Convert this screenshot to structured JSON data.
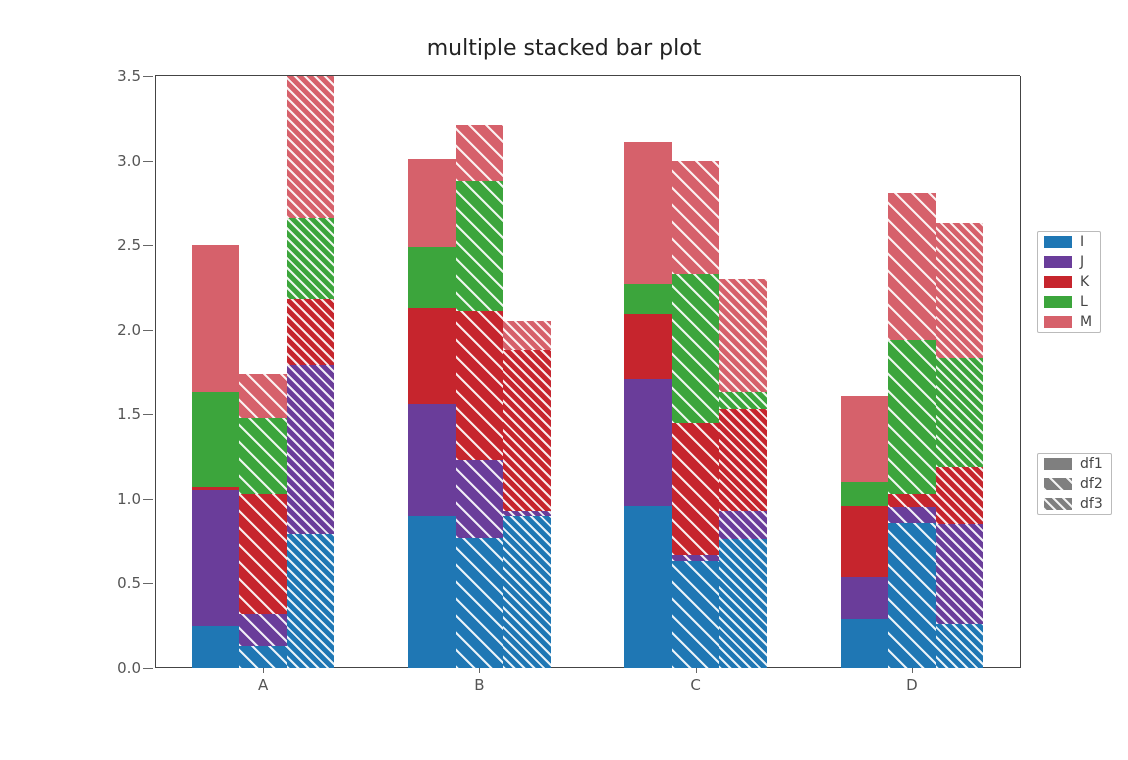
{
  "chart_data": {
    "type": "bar",
    "title": "multiple stacked bar plot",
    "xlabel": "",
    "ylabel": "",
    "ylim": [
      0,
      3.5
    ],
    "categories": [
      "A",
      "B",
      "C",
      "D"
    ],
    "stack_order": [
      "I",
      "J",
      "K",
      "L",
      "M"
    ],
    "groups": [
      {
        "name": "df1",
        "hatch": "solid",
        "series": [
          {
            "name": "I",
            "values": [
              0.25,
              0.9,
              0.96,
              0.29
            ]
          },
          {
            "name": "J",
            "values": [
              0.8,
              0.66,
              0.75,
              0.25
            ]
          },
          {
            "name": "K",
            "values": [
              0.02,
              0.57,
              0.38,
              0.42
            ]
          },
          {
            "name": "L",
            "values": [
              0.56,
              0.36,
              0.18,
              0.14
            ]
          },
          {
            "name": "M",
            "values": [
              0.87,
              0.52,
              0.84,
              0.51
            ]
          }
        ]
      },
      {
        "name": "df2",
        "hatch": "sparse",
        "series": [
          {
            "name": "I",
            "values": [
              0.13,
              0.77,
              0.63,
              0.86
            ]
          },
          {
            "name": "J",
            "values": [
              0.19,
              0.46,
              0.04,
              0.09
            ]
          },
          {
            "name": "K",
            "values": [
              0.71,
              0.88,
              0.78,
              0.08
            ]
          },
          {
            "name": "L",
            "values": [
              0.45,
              0.77,
              0.88,
              0.91
            ]
          },
          {
            "name": "M",
            "values": [
              0.26,
              0.33,
              0.67,
              0.87
            ]
          }
        ]
      },
      {
        "name": "df3",
        "hatch": "dense",
        "series": [
          {
            "name": "I",
            "values": [
              0.79,
              0.9,
              0.76,
              0.26
            ]
          },
          {
            "name": "J",
            "values": [
              1.0,
              0.03,
              0.17,
              0.59
            ]
          },
          {
            "name": "K",
            "values": [
              0.39,
              0.95,
              0.6,
              0.34
            ]
          },
          {
            "name": "L",
            "values": [
              0.48,
              0.0,
              0.1,
              0.64
            ]
          },
          {
            "name": "M",
            "values": [
              0.85,
              0.17,
              0.67,
              0.8
            ]
          }
        ]
      }
    ],
    "yticks": [
      0.0,
      0.5,
      1.0,
      1.5,
      2.0,
      2.5,
      3.0,
      3.5
    ],
    "colors": {
      "I": "#1f77b4",
      "J": "#6a3d9a",
      "K": "#c6252d",
      "L": "#3ca53c",
      "M": "#d6616b"
    }
  },
  "legend_series": [
    {
      "key": "I",
      "label": "I"
    },
    {
      "key": "J",
      "label": "J"
    },
    {
      "key": "K",
      "label": "K"
    },
    {
      "key": "L",
      "label": "L"
    },
    {
      "key": "M",
      "label": "M"
    }
  ],
  "legend_groups": [
    {
      "key": "df1",
      "label": "df1"
    },
    {
      "key": "df2",
      "label": "df2"
    },
    {
      "key": "df3",
      "label": "df3"
    }
  ]
}
